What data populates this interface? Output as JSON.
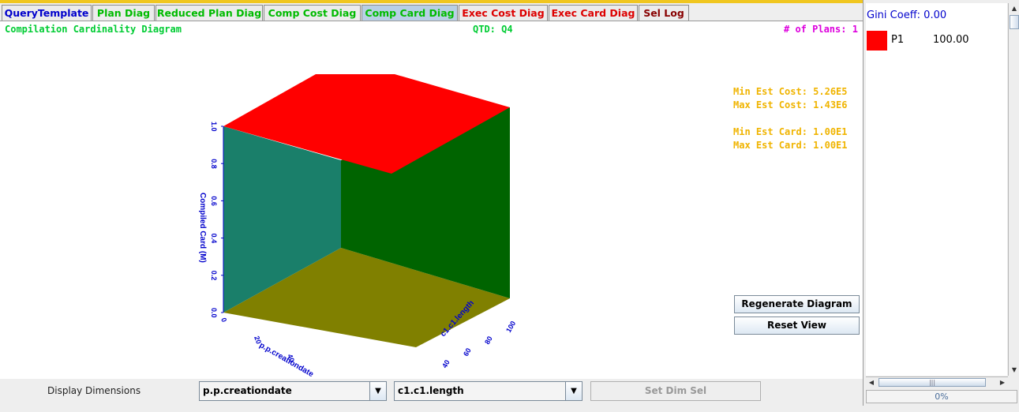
{
  "tabs": [
    {
      "label": "QueryTemplate",
      "color": "#0000cc"
    },
    {
      "label": "Plan Diag",
      "color": "#00bb00"
    },
    {
      "label": "Reduced Plan Diag",
      "color": "#00bb00"
    },
    {
      "label": "Comp Cost Diag",
      "color": "#00bb00"
    },
    {
      "label": "Comp Card Diag",
      "color": "#00bb00"
    },
    {
      "label": "Exec Cost Diag",
      "color": "#dd0000"
    },
    {
      "label": "Exec Card Diag",
      "color": "#dd0000"
    },
    {
      "label": "Sel Log",
      "color": "#880000"
    }
  ],
  "active_tab": "Comp Card Diag",
  "header": {
    "title": "Compilation Cardinality Diagram",
    "qtd": "QTD: Q4",
    "plans": "# of Plans: 1"
  },
  "stats": {
    "min_est_cost": "Min Est Cost: 5.26E5",
    "max_est_cost": "Max Est Cost: 1.43E6",
    "min_est_card": "Min Est Card: 1.00E1",
    "max_est_card": "Max Est Card: 1.00E1"
  },
  "diagram": {
    "z_axis_label": "Compiled Card (M)",
    "z_ticks": [
      "0.0",
      "0.2",
      "0.4",
      "0.6",
      "0.8",
      "1.0"
    ],
    "x_ticks": [
      "0",
      "20",
      "40"
    ],
    "x_axis_label": "p.p.creationdate",
    "y_ticks": [
      "40",
      "60",
      "80",
      "100"
    ],
    "y_axis_label": "c1.c1.length",
    "colors": {
      "top": "#ff0000",
      "left_wall": "#1a7f6a",
      "right_wall": "#006400",
      "floor": "#808000",
      "axis": "#0000cc"
    }
  },
  "buttons": {
    "regenerate": "Regenerate Diagram",
    "reset": "Reset View",
    "set_dim_sel": "Set Dim Sel"
  },
  "bottom": {
    "display_dimensions": "Display Dimensions",
    "dim1": "p.p.creationdate",
    "dim2": "c1.c1.length"
  },
  "side": {
    "gini": "Gini Coeff: 0.00",
    "plans": [
      {
        "name": "P1",
        "value": "100.00",
        "color": "#ff0000"
      }
    ],
    "progress": "0%"
  }
}
